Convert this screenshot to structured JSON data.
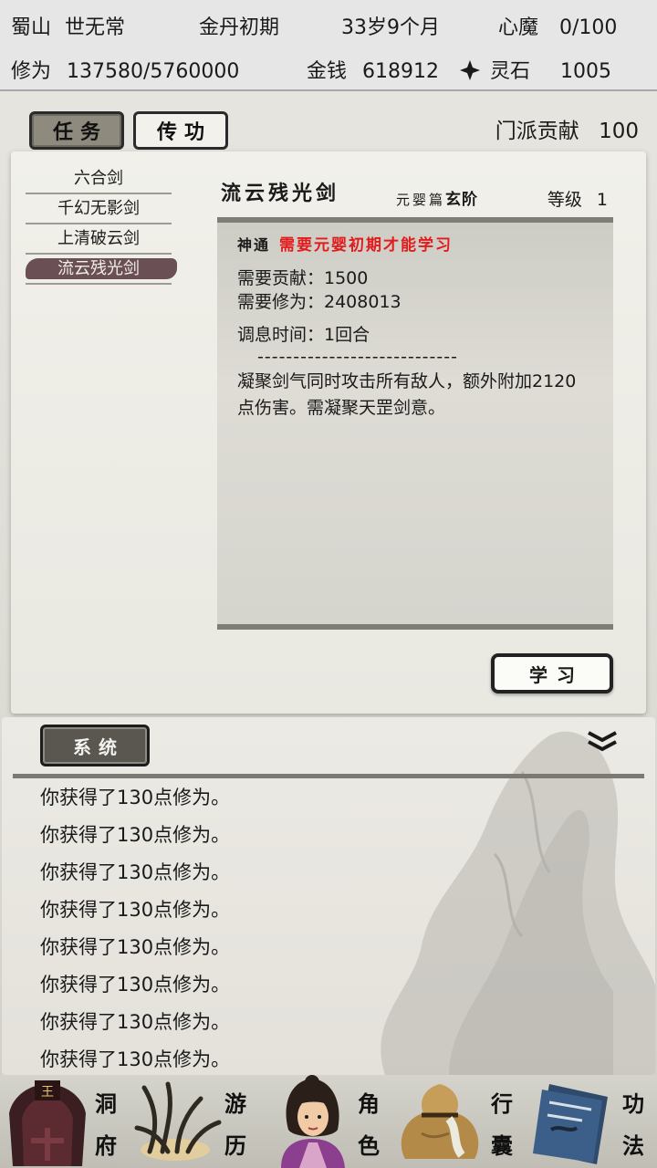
{
  "header": {
    "sect": "蜀山",
    "name": "世无常",
    "realm": "金丹初期",
    "age": "33岁9个月",
    "xinmo_label": "心魔",
    "xinmo_value": "0/100",
    "xiuwei_label": "修为",
    "xiuwei_value": "137580/5760000",
    "money_label": "金钱",
    "money_value": "618912",
    "lingshi_label": "灵石",
    "lingshi_value": "1005"
  },
  "tabs": {
    "renwu": "任务",
    "chuangong": "传功"
  },
  "contribution": {
    "label": "门派贡献",
    "value": "100"
  },
  "skills": [
    "六合剑",
    "千幻无影剑",
    "上清破云剑",
    "流云残光剑"
  ],
  "skill_detail": {
    "name": "流云残光剑",
    "book": "元婴篇",
    "tier": "玄阶",
    "level_label": "等级",
    "level_value": "1",
    "type": "神通",
    "requirement": "需要元婴初期才能学习",
    "cost_contribution": "需要贡献：1500",
    "cost_xiuwei": "需要修为：2408013",
    "cooldown": "调息时间：1回合",
    "separator": "----------------------------",
    "effect": "凝聚剑气同时攻击所有敌人，额外附加2120点伤害。需凝聚天罡剑意。"
  },
  "learn_button": "学习",
  "log": {
    "tab": "系统",
    "lines": [
      "你获得了130点修为。",
      "你获得了130点修为。",
      "你获得了130点修为。",
      "你获得了130点修为。",
      "你获得了130点修为。",
      "你获得了130点修为。",
      "你获得了130点修为。",
      "你获得了130点修为。"
    ]
  },
  "nav": {
    "dongfu": [
      "洞",
      "府"
    ],
    "youli": [
      "游",
      "历"
    ],
    "juese": [
      "角",
      "色"
    ],
    "xingnang": [
      "行",
      "囊"
    ],
    "gongfa": [
      "功",
      "法"
    ]
  },
  "colors": {
    "requirement_red": "#e21c1c",
    "selected_item": "#5e4146",
    "log_tab": "#5a5751"
  }
}
